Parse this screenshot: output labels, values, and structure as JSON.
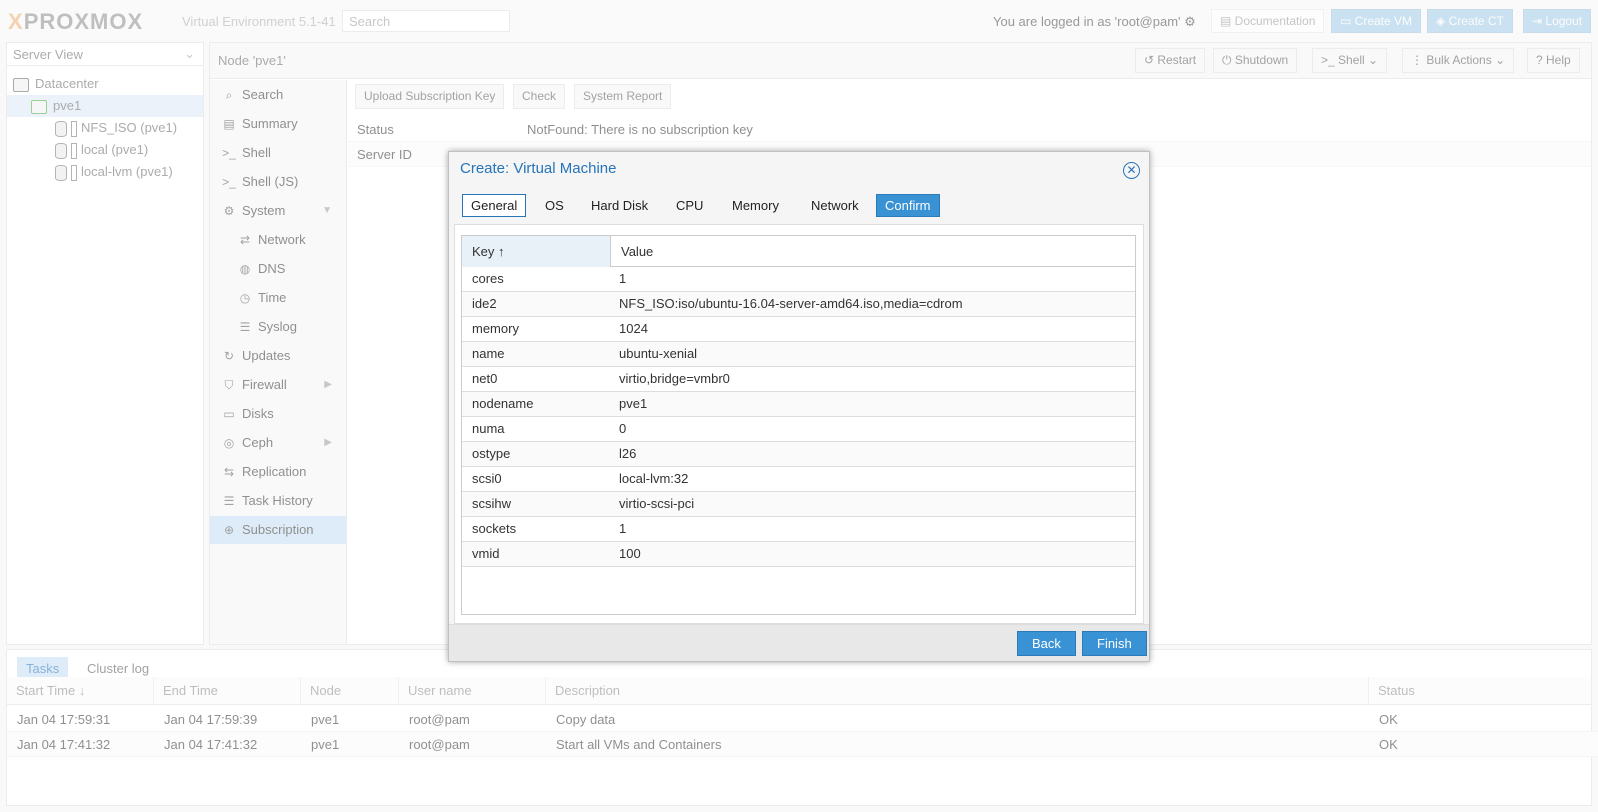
{
  "topbar": {
    "logo": "PROXMOX",
    "version": "Virtual Environment 5.1-41",
    "search_placeholder": "Search",
    "login_text": "You are logged in as 'root@pam'",
    "documentation": "Documentation",
    "create_vm": "Create VM",
    "create_ct": "Create CT",
    "logout": "Logout"
  },
  "tree": {
    "view_select": "Server View",
    "items": [
      {
        "label": "Datacenter"
      },
      {
        "label": "pve1"
      },
      {
        "label": "NFS_ISO (pve1)"
      },
      {
        "label": "local (pve1)"
      },
      {
        "label": "local-lvm (pve1)"
      }
    ]
  },
  "node_header": {
    "title": "Node 'pve1'",
    "restart": "Restart",
    "shutdown": "Shutdown",
    "shell": "Shell",
    "bulk_actions": "Bulk Actions",
    "help": "Help"
  },
  "nav": {
    "items": [
      {
        "label": "Search",
        "icon": "search-icon"
      },
      {
        "label": "Summary",
        "icon": "book-icon"
      },
      {
        "label": "Shell",
        "icon": "terminal-icon"
      },
      {
        "label": "Shell (JS)",
        "icon": "terminal-icon"
      },
      {
        "label": "System",
        "icon": "gears-icon"
      },
      {
        "label": "Network",
        "icon": "exchange-icon"
      },
      {
        "label": "DNS",
        "icon": "globe-icon"
      },
      {
        "label": "Time",
        "icon": "clock-icon"
      },
      {
        "label": "Syslog",
        "icon": "list-icon"
      },
      {
        "label": "Updates",
        "icon": "refresh-icon"
      },
      {
        "label": "Firewall",
        "icon": "shield-icon"
      },
      {
        "label": "Disks",
        "icon": "hdd-icon"
      },
      {
        "label": "Ceph",
        "icon": "ceph-icon"
      },
      {
        "label": "Replication",
        "icon": "retweet-icon"
      },
      {
        "label": "Task History",
        "icon": "list-icon"
      },
      {
        "label": "Subscription",
        "icon": "support-icon"
      }
    ]
  },
  "subscription": {
    "upload_key": "Upload Subscription Key",
    "check": "Check",
    "system_report": "System Report",
    "status_label": "Status",
    "status_value": "NotFound: There is no subscription key",
    "server_id_label": "Server ID"
  },
  "dialog": {
    "title": "Create: Virtual Machine",
    "tabs": [
      "General",
      "OS",
      "Hard Disk",
      "CPU",
      "Memory",
      "Network",
      "Confirm"
    ],
    "col_key": "Key",
    "col_value": "Value",
    "rows": [
      {
        "key": "cores",
        "value": "1"
      },
      {
        "key": "ide2",
        "value": "NFS_ISO:iso/ubuntu-16.04-server-amd64.iso,media=cdrom"
      },
      {
        "key": "memory",
        "value": "1024"
      },
      {
        "key": "name",
        "value": "ubuntu-xenial"
      },
      {
        "key": "net0",
        "value": "virtio,bridge=vmbr0"
      },
      {
        "key": "nodename",
        "value": "pve1"
      },
      {
        "key": "numa",
        "value": "0"
      },
      {
        "key": "ostype",
        "value": "l26"
      },
      {
        "key": "scsi0",
        "value": "local-lvm:32"
      },
      {
        "key": "scsihw",
        "value": "virtio-scsi-pci"
      },
      {
        "key": "sockets",
        "value": "1"
      },
      {
        "key": "vmid",
        "value": "100"
      }
    ],
    "back": "Back",
    "finish": "Finish"
  },
  "tasks": {
    "tab_tasks": "Tasks",
    "tab_cluster_log": "Cluster log",
    "columns": [
      "Start Time",
      "End Time",
      "Node",
      "User name",
      "Description",
      "Status"
    ],
    "rows": [
      {
        "start": "Jan 04 17:59:31",
        "end": "Jan 04 17:59:39",
        "node": "pve1",
        "user": "root@pam",
        "desc": "Copy data",
        "status": "OK"
      },
      {
        "start": "Jan 04 17:41:32",
        "end": "Jan 04 17:41:32",
        "node": "pve1",
        "user": "root@pam",
        "desc": "Start all VMs and Containers",
        "status": "OK"
      }
    ]
  }
}
